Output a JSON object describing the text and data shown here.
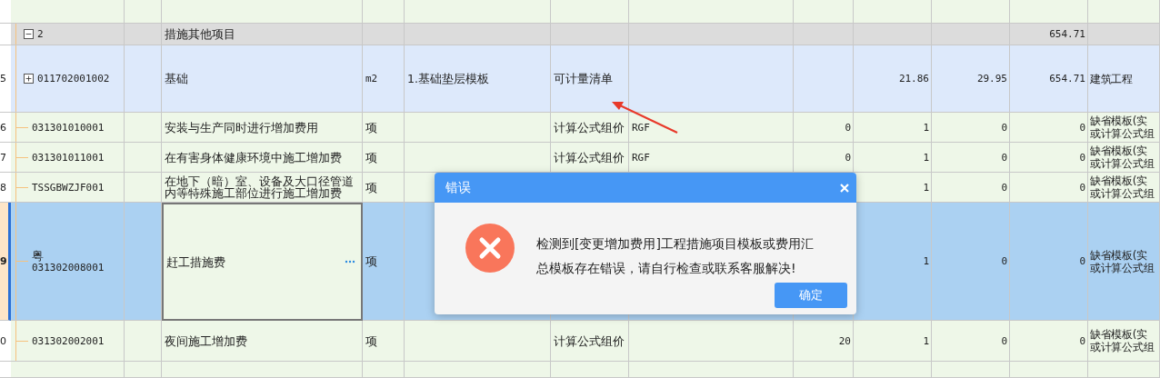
{
  "group_row": {
    "number": "2",
    "expanded": true,
    "name": "措施其他项目",
    "total": "654.71"
  },
  "rows": [
    {
      "index": "5",
      "kind": "parent",
      "expanded": false,
      "selected": false,
      "editing": false,
      "code": "011702001002",
      "name": "基础",
      "unit": "m2",
      "feature": "1.基础垫层模板",
      "method": "可计量清单",
      "column_10": "21.86",
      "column_11": "29.95",
      "column_12": "654.71",
      "category": [
        "建筑工程"
      ]
    },
    {
      "index": "6",
      "kind": "leaf",
      "selected": false,
      "editing": false,
      "code": "031301010001",
      "name": "安装与生产同时进行增加费用",
      "unit": "项",
      "method": "计算公式组价",
      "formula": "RGF",
      "column_9": "0",
      "column_10": "1",
      "column_11": "0",
      "column_12": "0",
      "category": [
        "缺省模板(实",
        "或计算公式组"
      ]
    },
    {
      "index": "7",
      "kind": "leaf",
      "selected": false,
      "editing": false,
      "code": "031301011001",
      "name": "在有害身体健康环境中施工增加费",
      "unit": "项",
      "method": "计算公式组价",
      "formula": "RGF",
      "column_9": "0",
      "column_10": "1",
      "column_11": "0",
      "column_12": "0",
      "category": [
        "缺省模板(实",
        "或计算公式组"
      ]
    },
    {
      "index": "8",
      "kind": "leaf",
      "selected": false,
      "editing": false,
      "code": "TSSGBWZJF001",
      "name": "在地下（暗）室、设备及大口径管道内等特殊施工部位进行施工增加费",
      "unit": "项",
      "column_10": "1",
      "column_11": "0",
      "column_12": "0",
      "category": [
        "缺省模板(实",
        "或计算公式组"
      ]
    },
    {
      "index": "9",
      "kind": "leaf",
      "selected": true,
      "editing": true,
      "code_prefix": "粤",
      "code": "031302008001",
      "name": "赶工措施费",
      "unit": "项",
      "column_10": "1",
      "column_11": "0",
      "column_12": "0",
      "category": [
        "缺省模板(实",
        "或计算公式组"
      ]
    },
    {
      "index": "0",
      "kind": "leaf",
      "selected": false,
      "editing": false,
      "code": "031302002001",
      "name": "夜间施工增加费",
      "unit": "项",
      "method": "计算公式组价",
      "column_9": "20",
      "column_10": "1",
      "column_11": "0",
      "column_12": "0",
      "category": [
        "缺省模板(实",
        "或计算公式组"
      ]
    }
  ],
  "dialog": {
    "title": "错误",
    "message": "检测到[变更增加费用]工程措施项目模板或费用汇总模板存在错误，请自行检查或联系客服解决!",
    "button": "确定"
  }
}
